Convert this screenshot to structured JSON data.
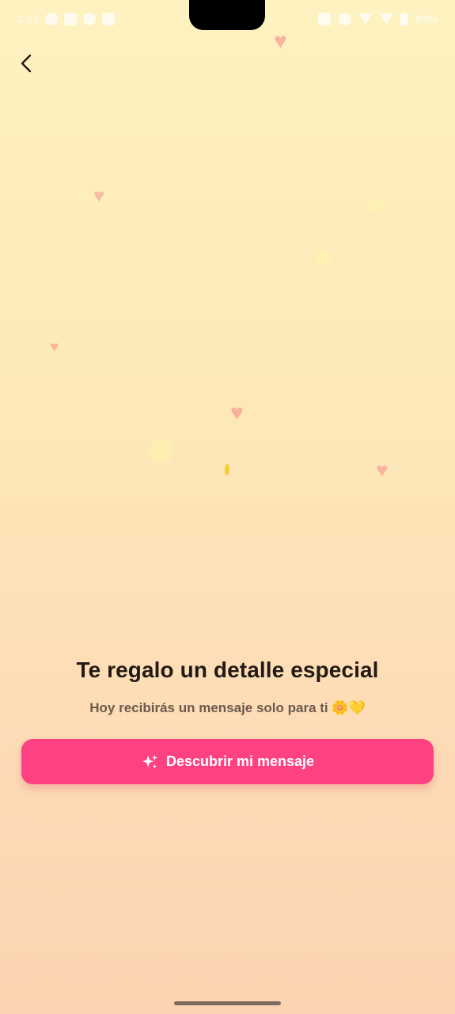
{
  "status_bar": {
    "time": "2:01",
    "battery": "85%"
  },
  "header": {
    "back_icon": "chevron-left-icon"
  },
  "decor": {
    "heart_glyph": "♥",
    "colors": {
      "heart": "#f9a898",
      "drop": "#f3d130"
    }
  },
  "main": {
    "title": "Te regalo un detalle especial",
    "subtitle": "Hoy recibirás un mensaje solo para ti 🌼💛"
  },
  "cta": {
    "label": "Descubrir mi mensaje",
    "icon": "sparkles-icon",
    "color": "#fd4182"
  }
}
